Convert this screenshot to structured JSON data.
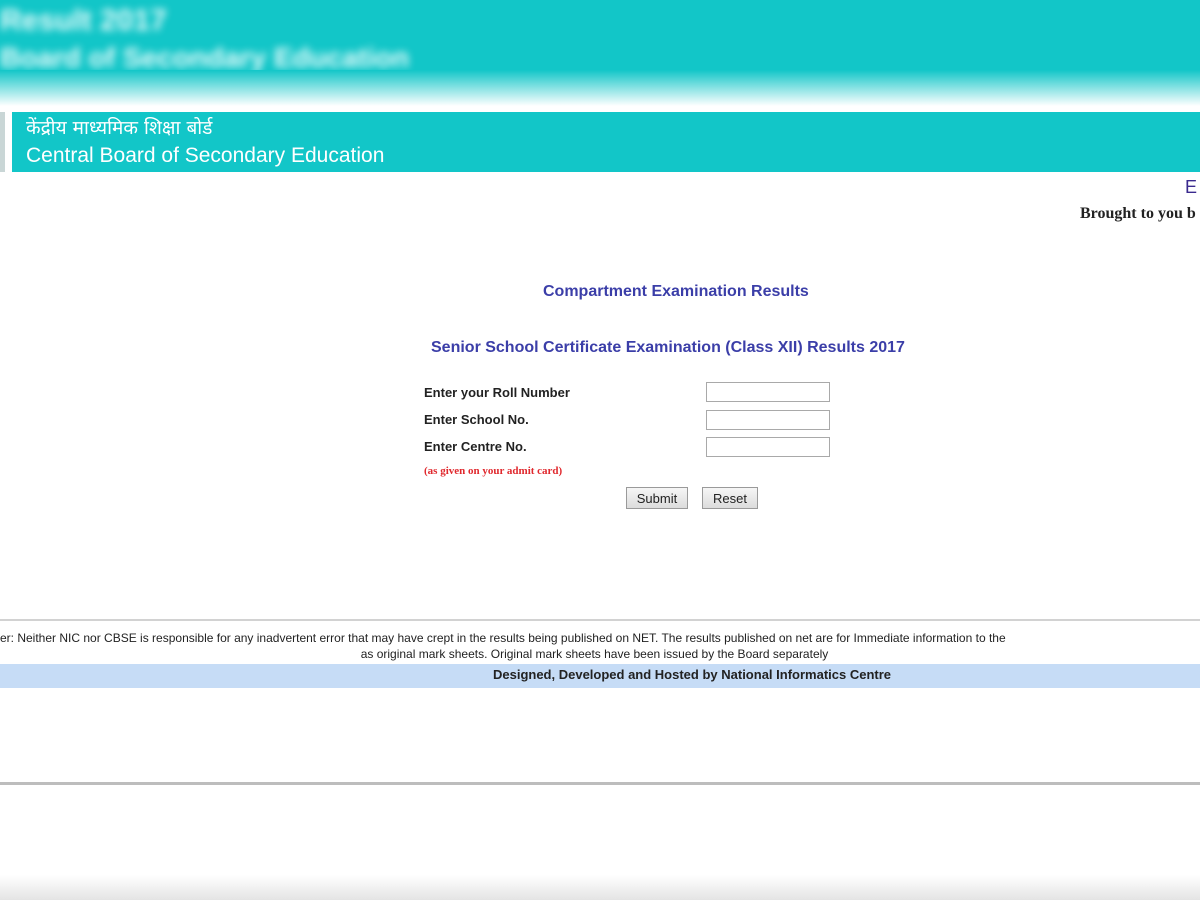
{
  "top_band": {
    "line_1": "Result 2017",
    "line_2": "Board of Secondary Education"
  },
  "header": {
    "hindi_title": "केंद्रीय माध्यमिक शिक्षा बोर्ड",
    "english_title": "Central Board of Secondary Education"
  },
  "right_edge": {
    "letter": "E",
    "brought_text": "Brought to you b"
  },
  "main": {
    "title": "Compartment Examination Results",
    "subtitle": "Senior School Certificate Examination (Class XII) Results 2017"
  },
  "form": {
    "roll_label": "Enter your Roll Number",
    "roll_value": "",
    "school_label": "Enter School No.",
    "school_value": "",
    "centre_label": "Enter Centre No.",
    "centre_value": "",
    "note": "(as given on your admit card)",
    "submit_label": "Submit",
    "reset_label": "Reset"
  },
  "footer": {
    "disclaimer_line_1": "er: Neither NIC nor CBSE is responsible for any inadvertent error that may have crept in the results being published on NET. The results published on net are for Immediate information to the",
    "disclaimer_line_2": "as original mark sheets. Original mark sheets have been issued by the Board separately",
    "credit": "Designed, Developed and Hosted by National Informatics Centre"
  },
  "colors": {
    "banner": "#12c6c8",
    "title": "#3b3ea8",
    "note": "#e0282d",
    "credit_bar": "#c6dcf6"
  }
}
